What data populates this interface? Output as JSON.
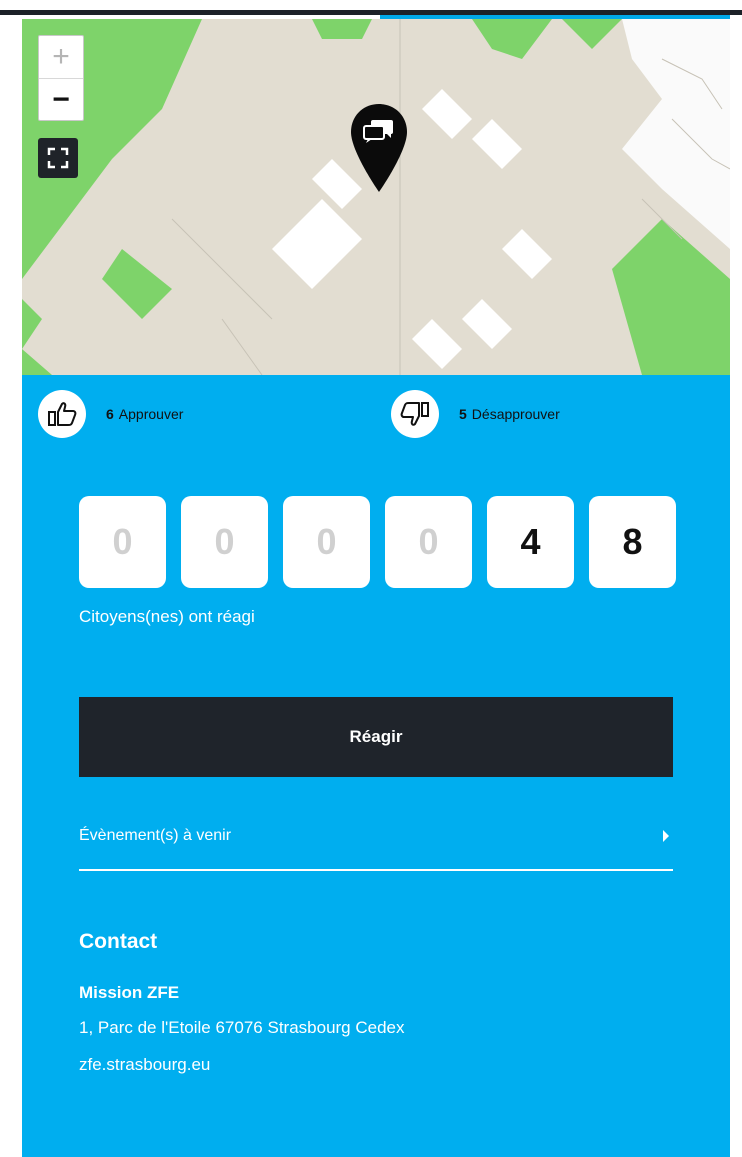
{
  "map": {
    "zoom_in_label": "+",
    "zoom_out_label": "−",
    "fullscreen_icon": "fullscreen-icon",
    "marker_icon": "comment-bubbles-icon"
  },
  "votes": {
    "approve": {
      "count": "6",
      "label": "Approuver",
      "icon": "thumbs-up-icon"
    },
    "disapprove": {
      "count": "5",
      "label": "Désapprouver",
      "icon": "thumbs-down-icon"
    }
  },
  "counter": {
    "digits": [
      "0",
      "0",
      "0",
      "0",
      "4",
      "8"
    ],
    "label": "Citoyens(nes) ont réagi"
  },
  "react_button": "Réagir",
  "events": {
    "label": "Évènement(s) à venir"
  },
  "contact": {
    "title": "Contact",
    "name": "Mission ZFE",
    "address": "1, Parc de l'Etoile 67076 Strasbourg Cedex",
    "website": "zfe.strasbourg.eu"
  },
  "colors": {
    "panel": "#00aeef",
    "dark": "#1f242b",
    "map_green": "#7ed36a",
    "map_building": "#e2ddd1"
  }
}
